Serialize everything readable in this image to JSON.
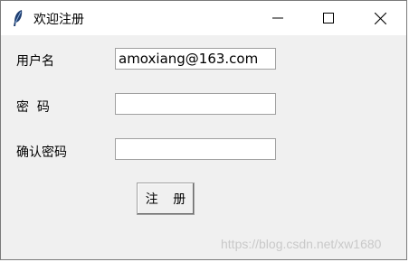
{
  "window": {
    "title": "欢迎注册",
    "icon": "feather-icon",
    "controls": [
      "minimize-icon",
      "maximize-icon",
      "close-icon"
    ]
  },
  "form": {
    "username_label": "用户名",
    "username_value": "amoxiang@163.com",
    "password_label": "密  码",
    "password_value": "",
    "confirm_label": "确认密码",
    "confirm_value": "",
    "submit_label": "注 册"
  },
  "watermark": "https://blog.csdn.net/xw1680"
}
